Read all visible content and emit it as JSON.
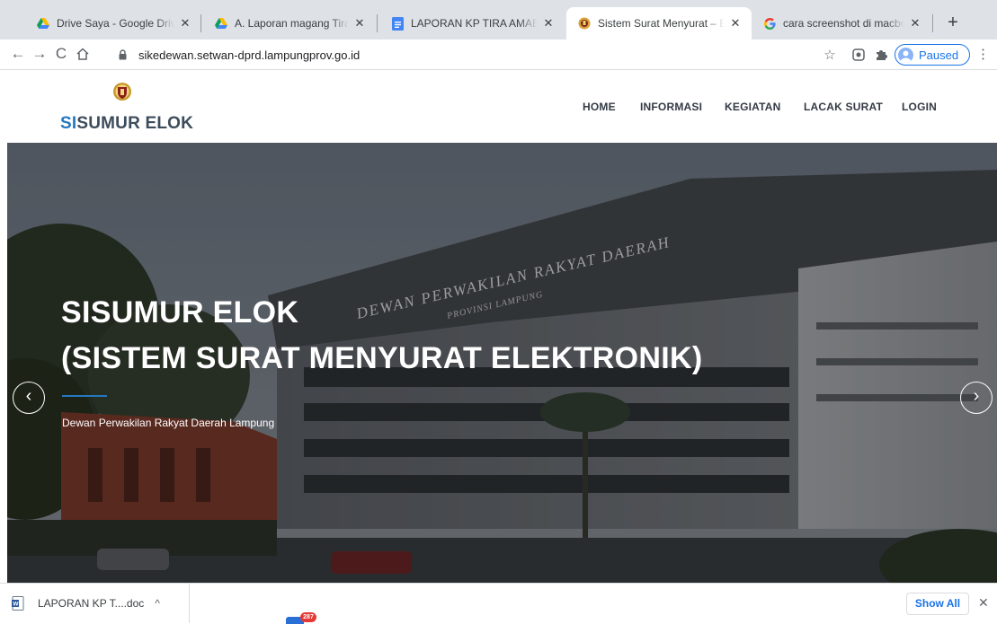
{
  "browser": {
    "tabs": [
      {
        "title": "Drive Saya - Google Drive",
        "icon": "google-drive-icon"
      },
      {
        "title": "A. Laporan magang Tira - Goo",
        "icon": "google-drive-icon"
      },
      {
        "title": "LAPORAN KP TIRA AMABELA",
        "icon": "google-docs-icon"
      },
      {
        "title": "Sistem Surat Menyurat – Elekt",
        "icon": "site-emblem-icon",
        "active": true
      },
      {
        "title": "cara screenshot di macbook -",
        "icon": "google-icon"
      }
    ],
    "url": "sikedewan.setwan-dprd.lampungprov.go.id",
    "profile_label": "Paused"
  },
  "site": {
    "logo_accent": "SI",
    "logo_rest": "SUMUR ELOK",
    "nav": [
      "HOME",
      "INFORMASI",
      "KEGIATAN",
      "LACAK SURAT",
      "LOGIN"
    ],
    "colors": {
      "accent": "#2478bf",
      "nav_text": "#333a45"
    }
  },
  "hero": {
    "title_line1": "SISUMUR ELOK",
    "title_line2": "(SISTEM SURAT MENYURAT ELEKTRONIK)",
    "subtitle": "Dewan Perwakilan Rakyat Daerah Lampung",
    "building_inscription": "DEWAN PERWAKILAN RAKYAT DAERAH",
    "building_inscription_sub": "PROVINSI LAMPUNG"
  },
  "downloads": {
    "file_name": "LAPORAN KP T....doc",
    "show_all": "Show All",
    "badge_count": "287"
  }
}
